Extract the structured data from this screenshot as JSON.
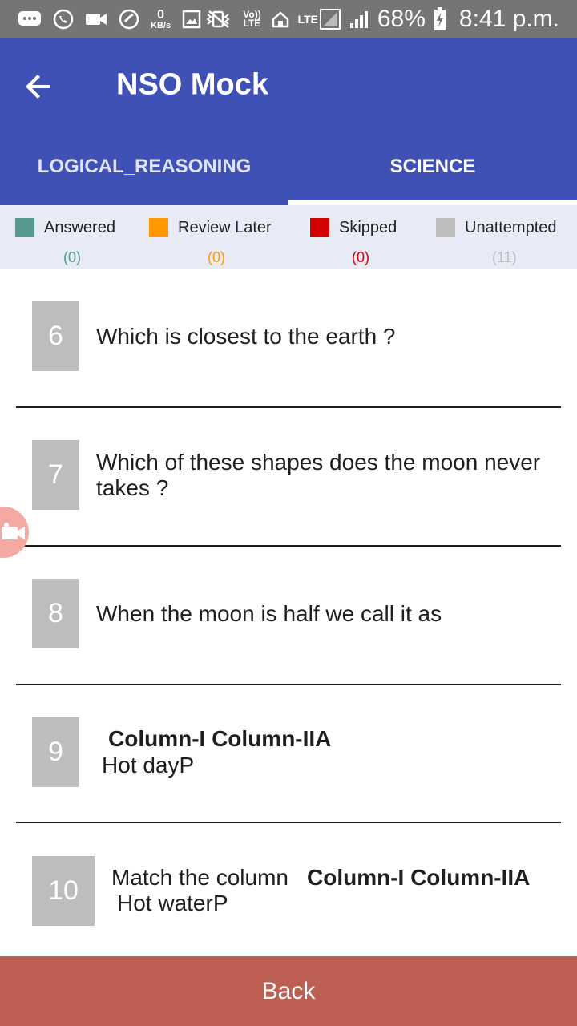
{
  "status_bar": {
    "speed_value": "0",
    "speed_unit": "KB/s",
    "volte": "Vo)) LTE",
    "lte": "LTE",
    "battery": "68%",
    "time": "8:41 p.m."
  },
  "header": {
    "title": "NSO Mock",
    "back_icon": "arrow-back-icon"
  },
  "tabs": [
    {
      "label": "LOGICAL_REASONING",
      "active": false
    },
    {
      "label": "SCIENCE",
      "active": true
    }
  ],
  "legend": [
    {
      "label": "Answered",
      "count": "(0)",
      "color": "#55998f"
    },
    {
      "label": "Review Later",
      "count": "(0)",
      "color": "#ff9800"
    },
    {
      "label": "Skipped",
      "count": "(0)",
      "color": "#d50000"
    },
    {
      "label": "Unattempted",
      "count": "(11)",
      "color": "#bdbdbd"
    }
  ],
  "questions": [
    {
      "number": "6",
      "text": "Which is closest to the earth ?"
    },
    {
      "number": "7",
      "text": "Which of these shapes does the moon never takes ?"
    },
    {
      "number": "8",
      "text": "When the moon is half we call it as"
    },
    {
      "number": "9",
      "text_bold": "Column-I  Column-IIA",
      "text2": "Hot dayP"
    },
    {
      "number": "10",
      "text_plain": "Match the column",
      "text_bold": "Column-I  Column-IIA",
      "text2": "Hot waterP"
    }
  ],
  "footer": {
    "back_label": "Back"
  }
}
